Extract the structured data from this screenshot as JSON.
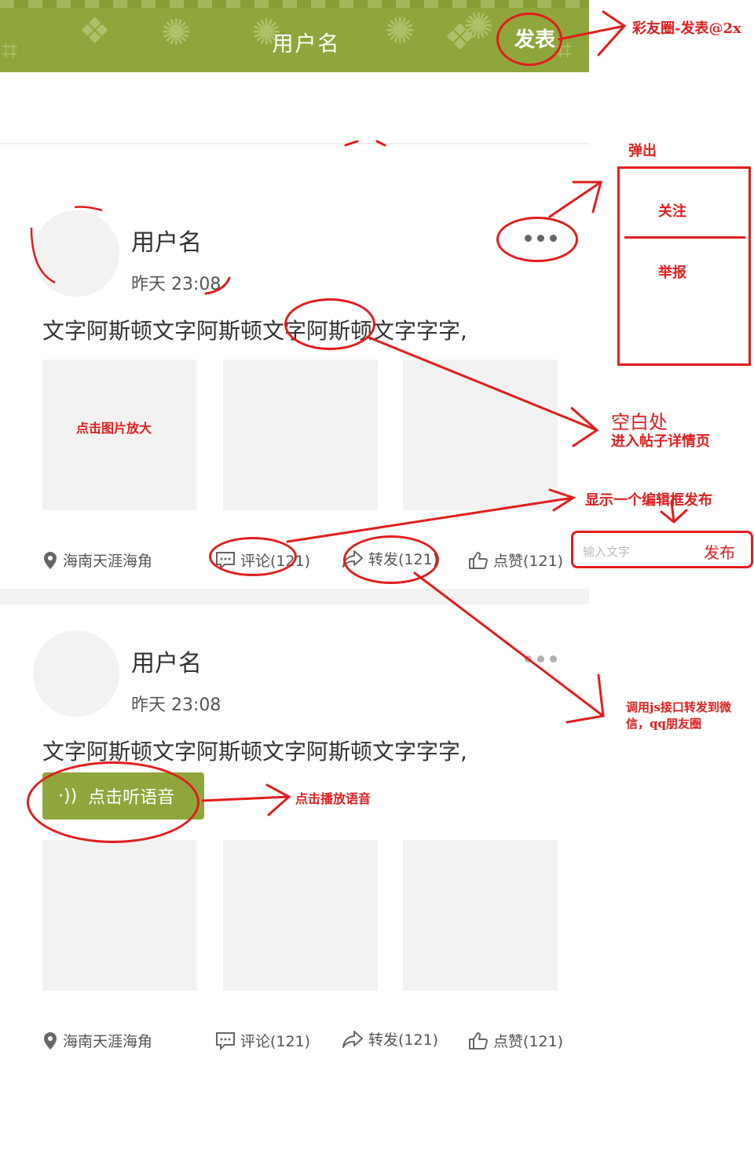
{
  "header": {
    "title": "用户名",
    "publish_label": "发表"
  },
  "posts": [
    {
      "username": "用户名",
      "time": "昨天 23:08",
      "text": "文字阿斯顿文字阿斯顿文字阿斯顿文字字字,",
      "location": "海南天涯海角",
      "comment": "评论(121)",
      "forward": "转发(121)",
      "like": "点赞(121)"
    },
    {
      "username": "用户名",
      "time": "昨天 23:08",
      "text": "文字阿斯顿文字阿斯顿文字阿斯顿文字字字,",
      "voice_label": "点击听语音",
      "location": "海南天涯海角",
      "comment": "评论(121)",
      "forward": "转发(121)",
      "like": "点赞(121)"
    }
  ],
  "annotations": {
    "publish_note": "彩友圈-发表@2x",
    "popup_title": "弹出",
    "popup_follow": "关注",
    "popup_report": "举报",
    "blank_area": "空白处",
    "enter_detail": "进入帖子详情页",
    "image_zoom": "点击图片放大",
    "show_editor": "显示一个编辑框发布",
    "editor_placeholder": "输入文字",
    "editor_publish": "发布",
    "forward_note_1": "调用js接口转发到微",
    "forward_note_2": "信，qq朋友圈",
    "voice_note": "点击播放语音"
  },
  "colors": {
    "theme_green": "#8fa63c",
    "annotation_red": "#e21d1d",
    "placeholder_gray": "#f2f2f2"
  }
}
